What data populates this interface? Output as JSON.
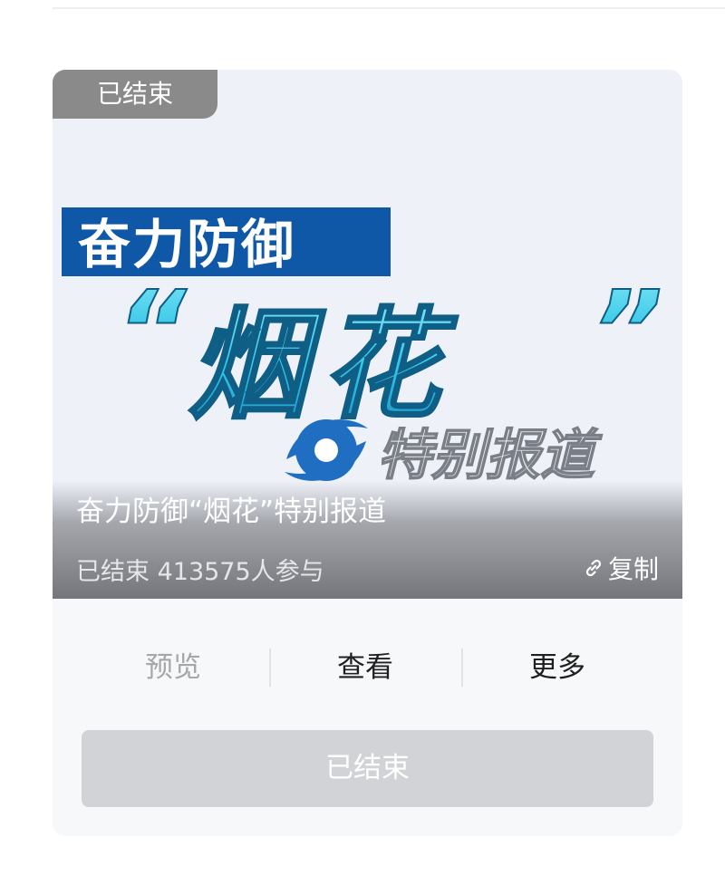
{
  "status_tag": "已结束",
  "poster": {
    "line1": "奋力防御",
    "open_quote": "“",
    "headline": "烟花",
    "close_quote": "”",
    "line3": "特别报道"
  },
  "card": {
    "title": "奋力防御“烟花”特别报道",
    "status": "已结束",
    "participants": "413575人参与",
    "copy_label": "复制"
  },
  "actions": {
    "preview_label": "预览",
    "view_label": "查看",
    "more_label": "更多"
  },
  "ended_button_label": "已结束",
  "colors": {
    "tag_bg": "#8a8a8a",
    "poster_blue": "#0f58a8",
    "headline_cyan": "#35c6e6",
    "disabled_button": "#d2d3d7"
  }
}
